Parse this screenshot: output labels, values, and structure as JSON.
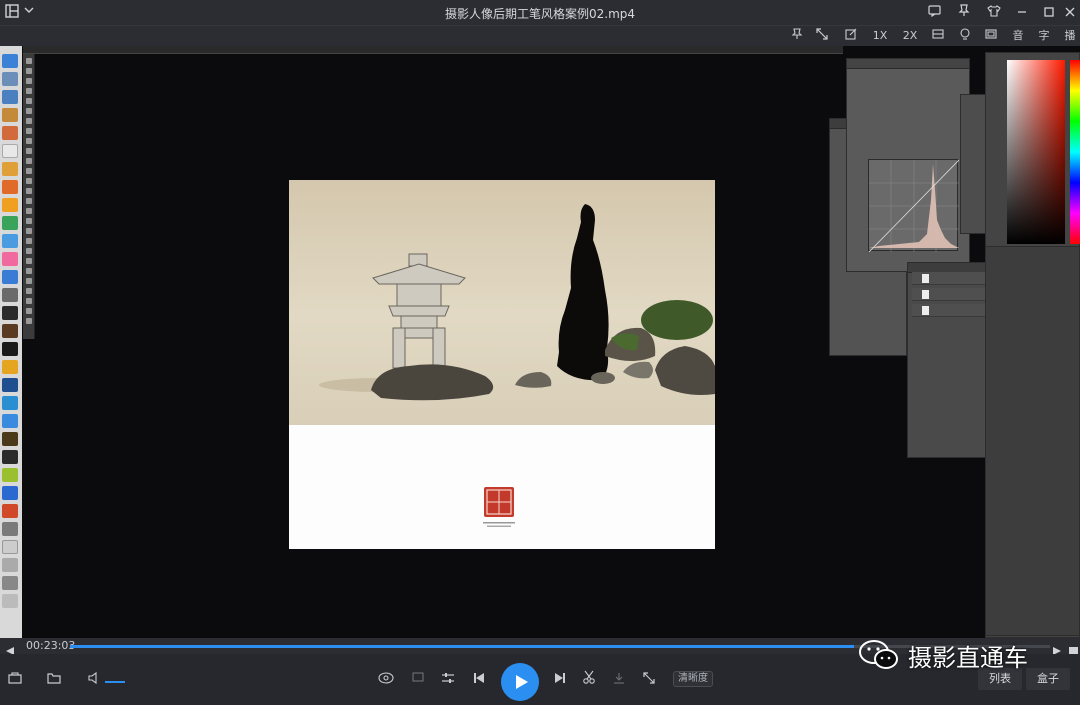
{
  "window": {
    "title": "摄影人像后期工笔风格案例02.mp4"
  },
  "toolbar": {
    "speed1": "1X",
    "speed2": "2X",
    "music": "音",
    "subtitle": "字",
    "capture": "播"
  },
  "player": {
    "elapsed": "00:23:03",
    "progress": 0.8,
    "quality_label": "清晰度",
    "playlist_label": "列表",
    "box_label": "盒子"
  },
  "watermark": {
    "text": "摄影直通车"
  },
  "accent": "#2b8ff2",
  "icons": {
    "menu": "app-menu-icon",
    "play": "play-icon",
    "prev": "prev-icon",
    "next": "next-icon"
  }
}
